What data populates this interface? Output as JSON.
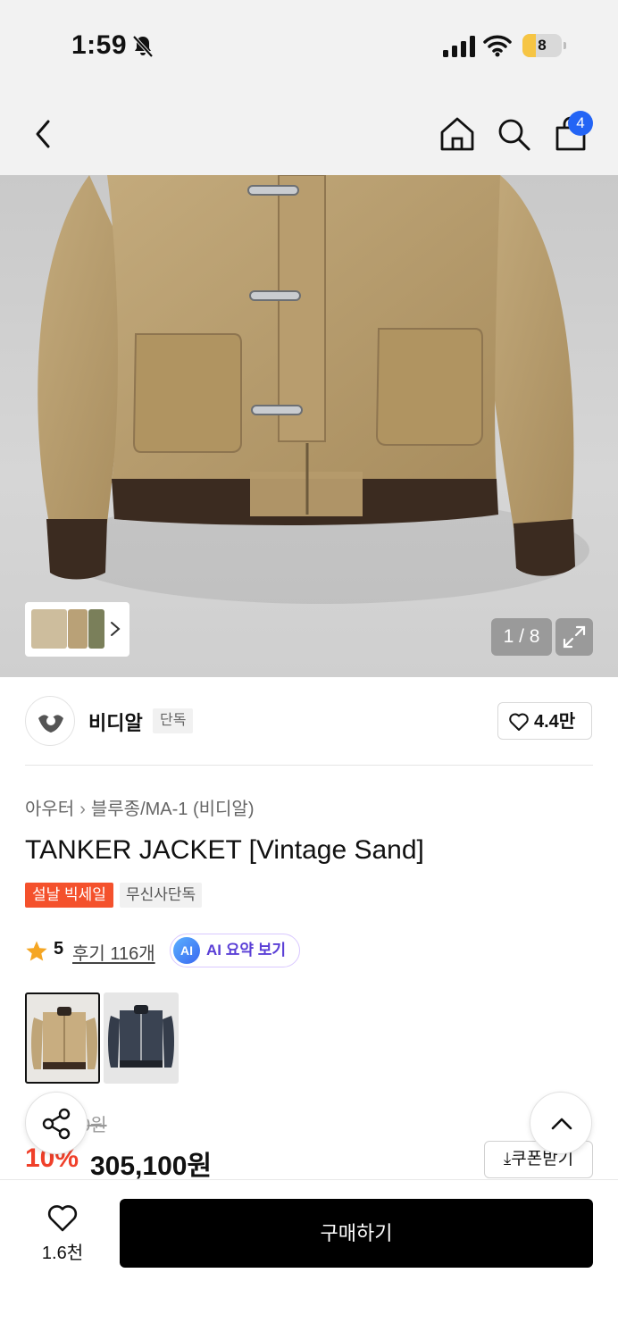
{
  "status_bar": {
    "time": "1:59",
    "battery_level": "8",
    "battery_fraction": 0.08,
    "icons": [
      "bell-slash-icon",
      "signal-icon",
      "wifi-icon",
      "battery-icon"
    ]
  },
  "nav": {
    "cart_count": "4",
    "icons": [
      "back-icon",
      "home-icon",
      "search-icon",
      "shopping-bag-icon"
    ]
  },
  "gallery": {
    "counter": "1 / 8",
    "icons": [
      "chevron-right-icon",
      "expand-icon"
    ]
  },
  "brand": {
    "name": "비디알",
    "tag": "단독",
    "likes": "4.4만"
  },
  "breadcrumb": {
    "category": "아우터",
    "subcategory": "블루종/MA-1 (비디알)"
  },
  "product": {
    "title": "TANKER JACKET [Vintage Sand]",
    "badges": [
      "설날 빅세일",
      "무신사단독"
    ],
    "rating": "5",
    "reviews": "후기 116개",
    "ai_label": "AI",
    "ai_summary": "AI 요약 보기",
    "options": [
      "Vintage Sand",
      "Navy"
    ]
  },
  "price": {
    "original": "0원",
    "discount": "10%",
    "final": "305,100원",
    "coupon": "쿠폰받기"
  },
  "bottom": {
    "wish_count": "1.6천",
    "buy_label": "구매하기"
  },
  "colors": {
    "accent_red": "#f0402a",
    "sale_badge": "#f4512c",
    "badge_blue": "#2364f5",
    "ai_purple": "#5a3fd6",
    "star": "#f5a623"
  }
}
